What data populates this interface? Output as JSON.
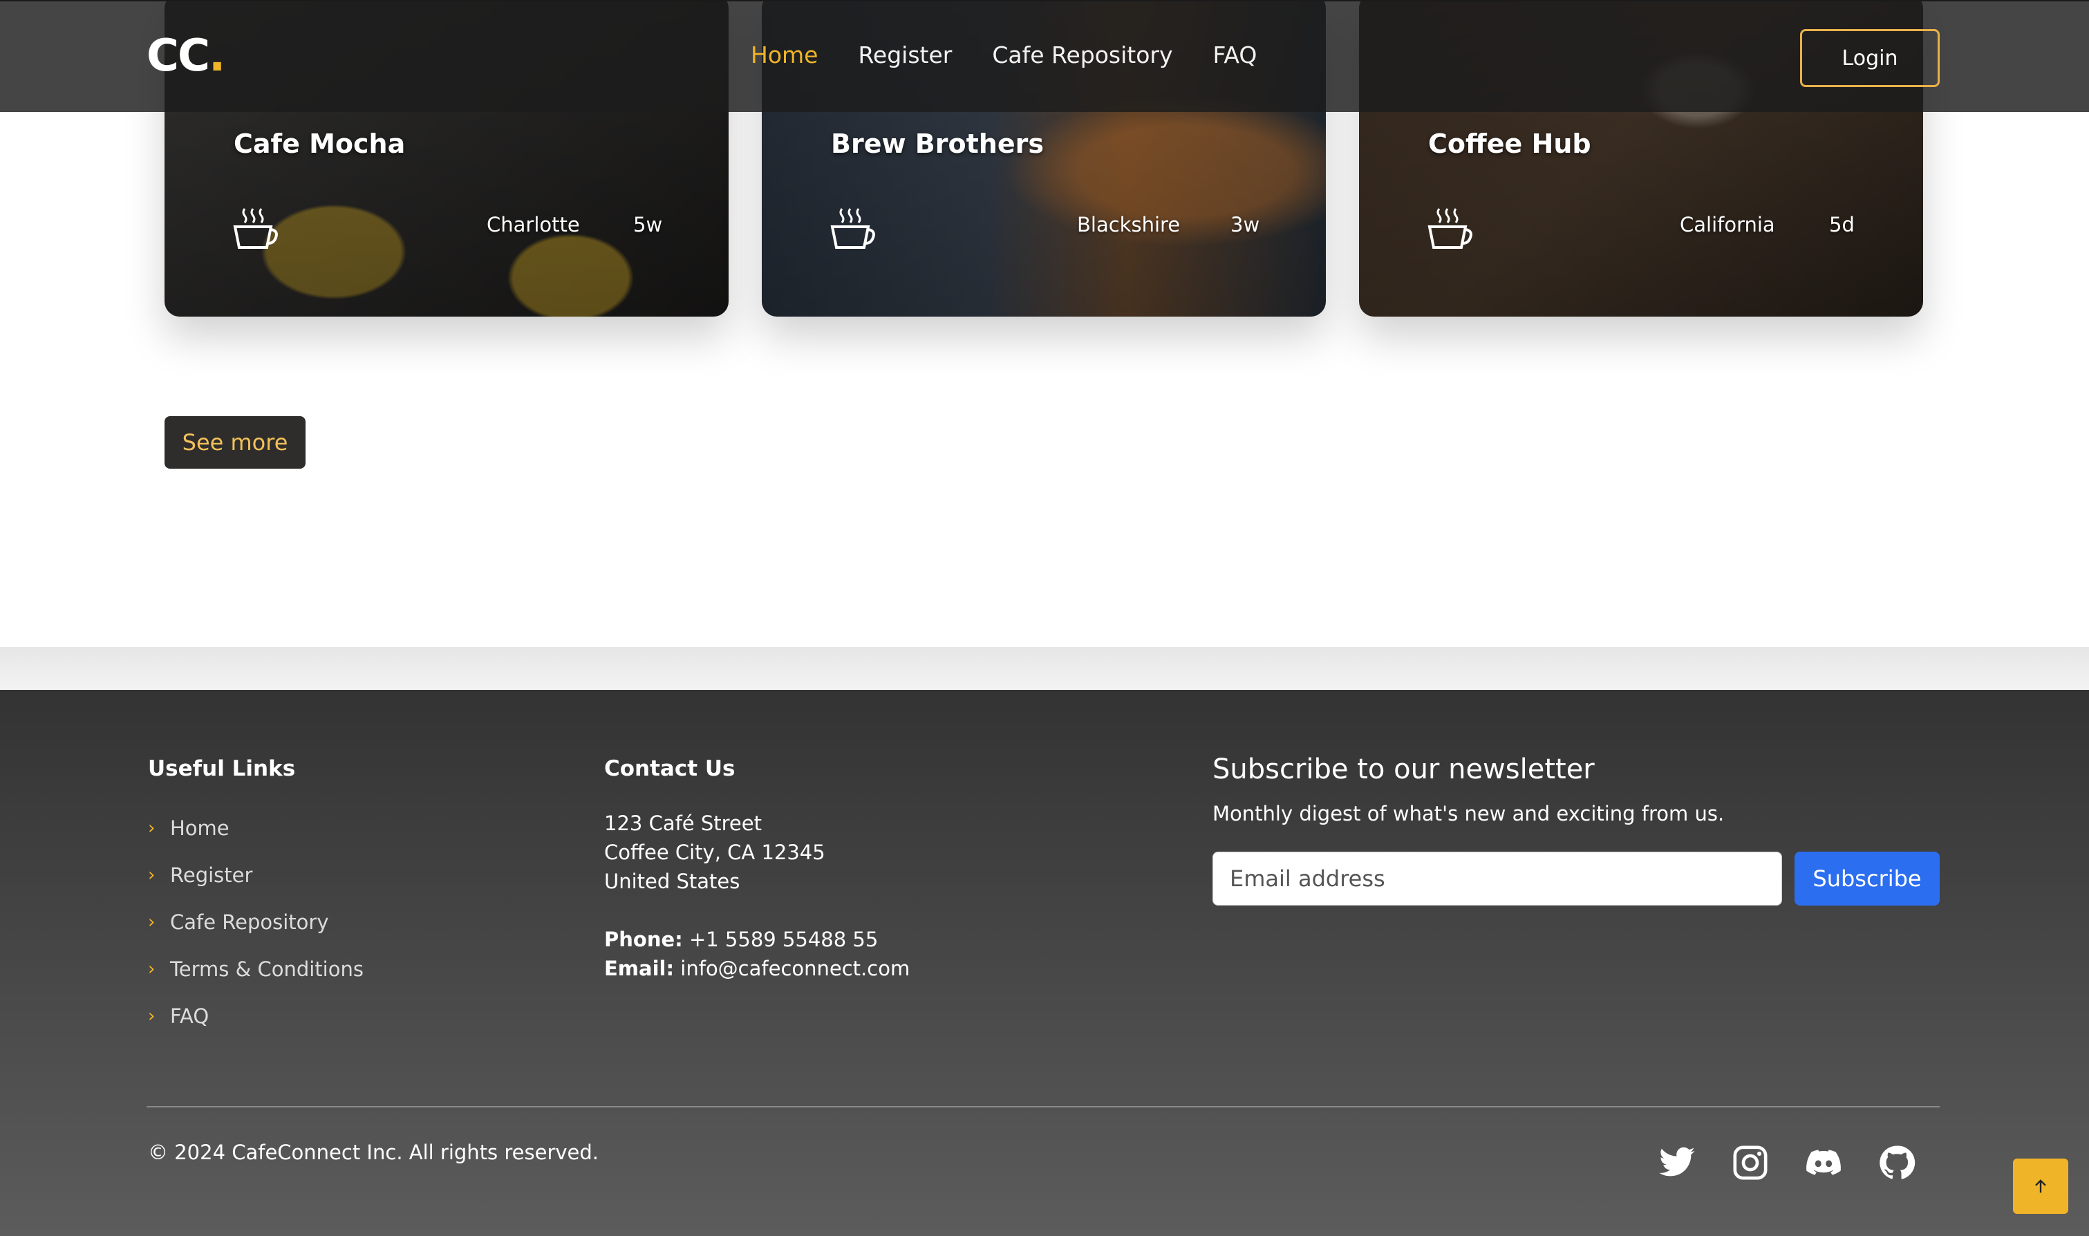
{
  "brand": {
    "logo_text": "CC",
    "logo_dot": "."
  },
  "nav": {
    "items": [
      {
        "label": "Home",
        "active": true
      },
      {
        "label": "Register"
      },
      {
        "label": "Cafe Repository"
      },
      {
        "label": "FAQ"
      }
    ],
    "login_label": "Login"
  },
  "cards": [
    {
      "title": "Cafe Mocha",
      "location": "Charlotte",
      "age": "5w",
      "icon": "coffee-cup-icon"
    },
    {
      "title": "Brew Brothers",
      "location": "Blackshire",
      "age": "3w",
      "icon": "coffee-cup-icon"
    },
    {
      "title": "Coffee Hub",
      "location": "California",
      "age": "5d",
      "icon": "coffee-cup-icon"
    }
  ],
  "see_more_label": "See more",
  "footer": {
    "useful_links_heading": "Useful Links",
    "links": [
      "Home",
      "Register",
      "Cafe Repository",
      "Terms & Conditions",
      "FAQ"
    ],
    "contact_heading": "Contact Us",
    "address_line1": "123 Café Street",
    "address_line2": "Coffee City, CA 12345",
    "address_line3": "United States",
    "phone_label": "Phone:",
    "phone": "+1 5589 55488 55",
    "email_label": "Email:",
    "email": "info@cafeconnect.com",
    "newsletter_title": "Subscribe to our newsletter",
    "newsletter_sub": "Monthly digest of what's new and exciting from us.",
    "email_placeholder": "Email address",
    "subscribe_label": "Subscribe",
    "copyright": "© 2024 CafeConnect Inc. All rights reserved.",
    "socials": [
      "twitter-icon",
      "instagram-icon",
      "discord-icon",
      "github-icon"
    ]
  },
  "colors": {
    "accent": "#f0b429",
    "subscribe": "#2b6ef0",
    "navbar": "#1c1c1c"
  }
}
